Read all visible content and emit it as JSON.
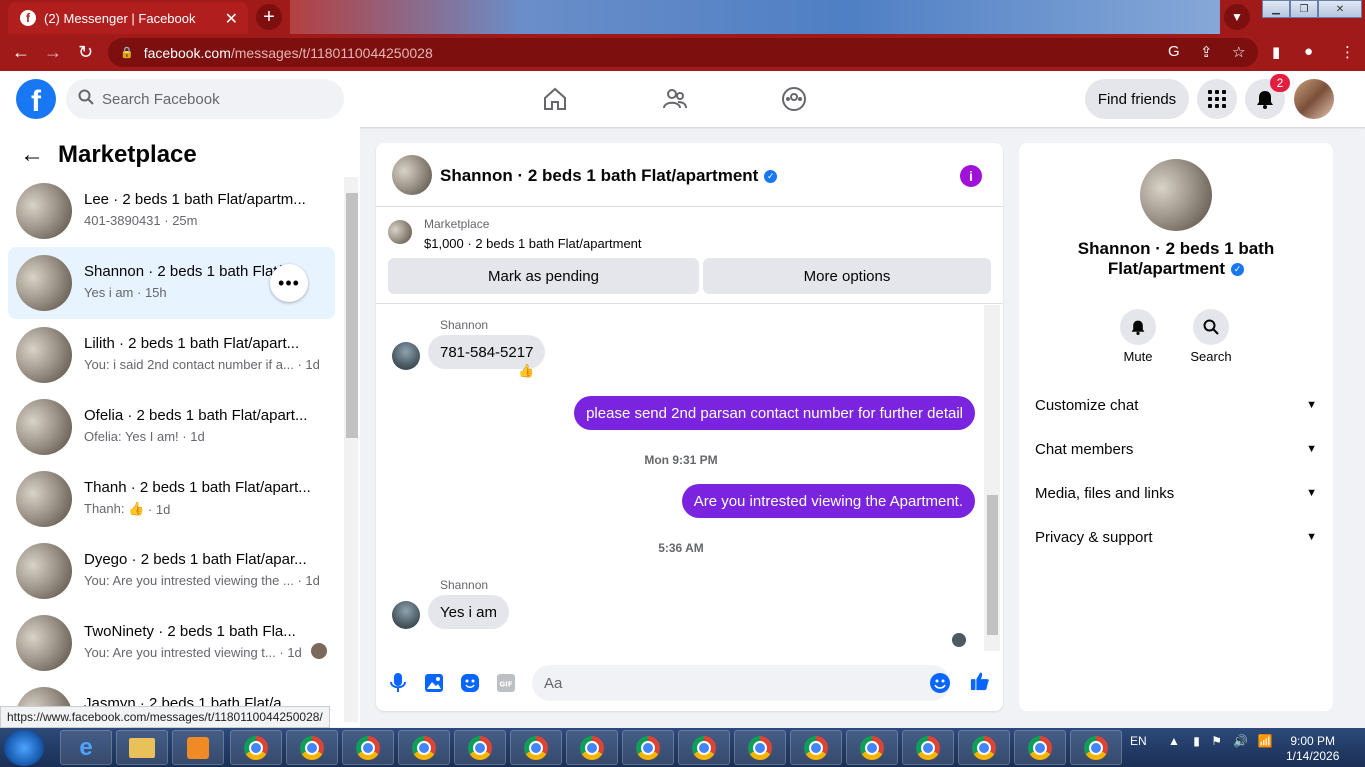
{
  "browser": {
    "tab_title": "(2) Messenger | Facebook",
    "url_host": "facebook.com",
    "url_path": "/messages/t/1180110044250028",
    "status_url": "https://www.facebook.com/messages/t/1180110044250028/"
  },
  "header": {
    "search_placeholder": "Search Facebook",
    "find_friends": "Find friends",
    "notification_count": "2"
  },
  "sidebar": {
    "title": "Marketplace",
    "conversations": [
      {
        "name": "Lee · 2 beds 1 bath Flat/apartm...",
        "preview": "401-3890431",
        "time": "25m"
      },
      {
        "name": "Shannon · 2 beds 1 bath Flat/a...",
        "preview": "Yes i am",
        "time": "15h"
      },
      {
        "name": "Lilith · 2 beds 1 bath Flat/apart...",
        "preview": "You: i said 2nd contact number if a...",
        "time": "1d"
      },
      {
        "name": "Ofelia · 2 beds 1 bath Flat/apart...",
        "preview": "Ofelia: Yes I am!",
        "time": "1d"
      },
      {
        "name": "Thanh · 2 beds 1 bath Flat/apart...",
        "preview": "Thanh: 👍",
        "time": "1d"
      },
      {
        "name": "Dyego · 2 beds 1 bath Flat/apar...",
        "preview": "You: Are you intrested viewing the ...",
        "time": "1d"
      },
      {
        "name": "TwoNinety · 2 beds 1 bath Fla...",
        "preview": "You: Are you intrested viewing t...",
        "time": "1d"
      },
      {
        "name": "Jasmyn · 2 beds 1 bath Flat/a...",
        "preview": "",
        "time": ""
      }
    ]
  },
  "chat": {
    "title": "Shannon · 2 beds 1 bath Flat/apartment",
    "listing_source": "Marketplace",
    "listing_desc": "$1,000 · 2 beds 1 bath Flat/apartment",
    "btn_pending": "Mark as pending",
    "btn_more": "More options",
    "messages": {
      "sender1": "Shannon",
      "msg1": "781-584-5217",
      "msg2": "please send 2nd parsan contact number for further detail",
      "stamp1": "Mon 9:31 PM",
      "msg3": "Are you intrested viewing the Apartment.",
      "stamp2": "5:36 AM",
      "sender2": "Shannon",
      "msg4": "Yes i am"
    },
    "input_placeholder": "Aa"
  },
  "info_panel": {
    "name_line1": "Shannon · 2 beds 1 bath",
    "name_line2": "Flat/apartment",
    "mute_label": "Mute",
    "search_label": "Search",
    "sections": [
      "Customize chat",
      "Chat members",
      "Media, files and links",
      "Privacy & support"
    ]
  },
  "taskbar": {
    "lang": "EN",
    "time": "9:00 PM",
    "date": "1/14/2026"
  }
}
